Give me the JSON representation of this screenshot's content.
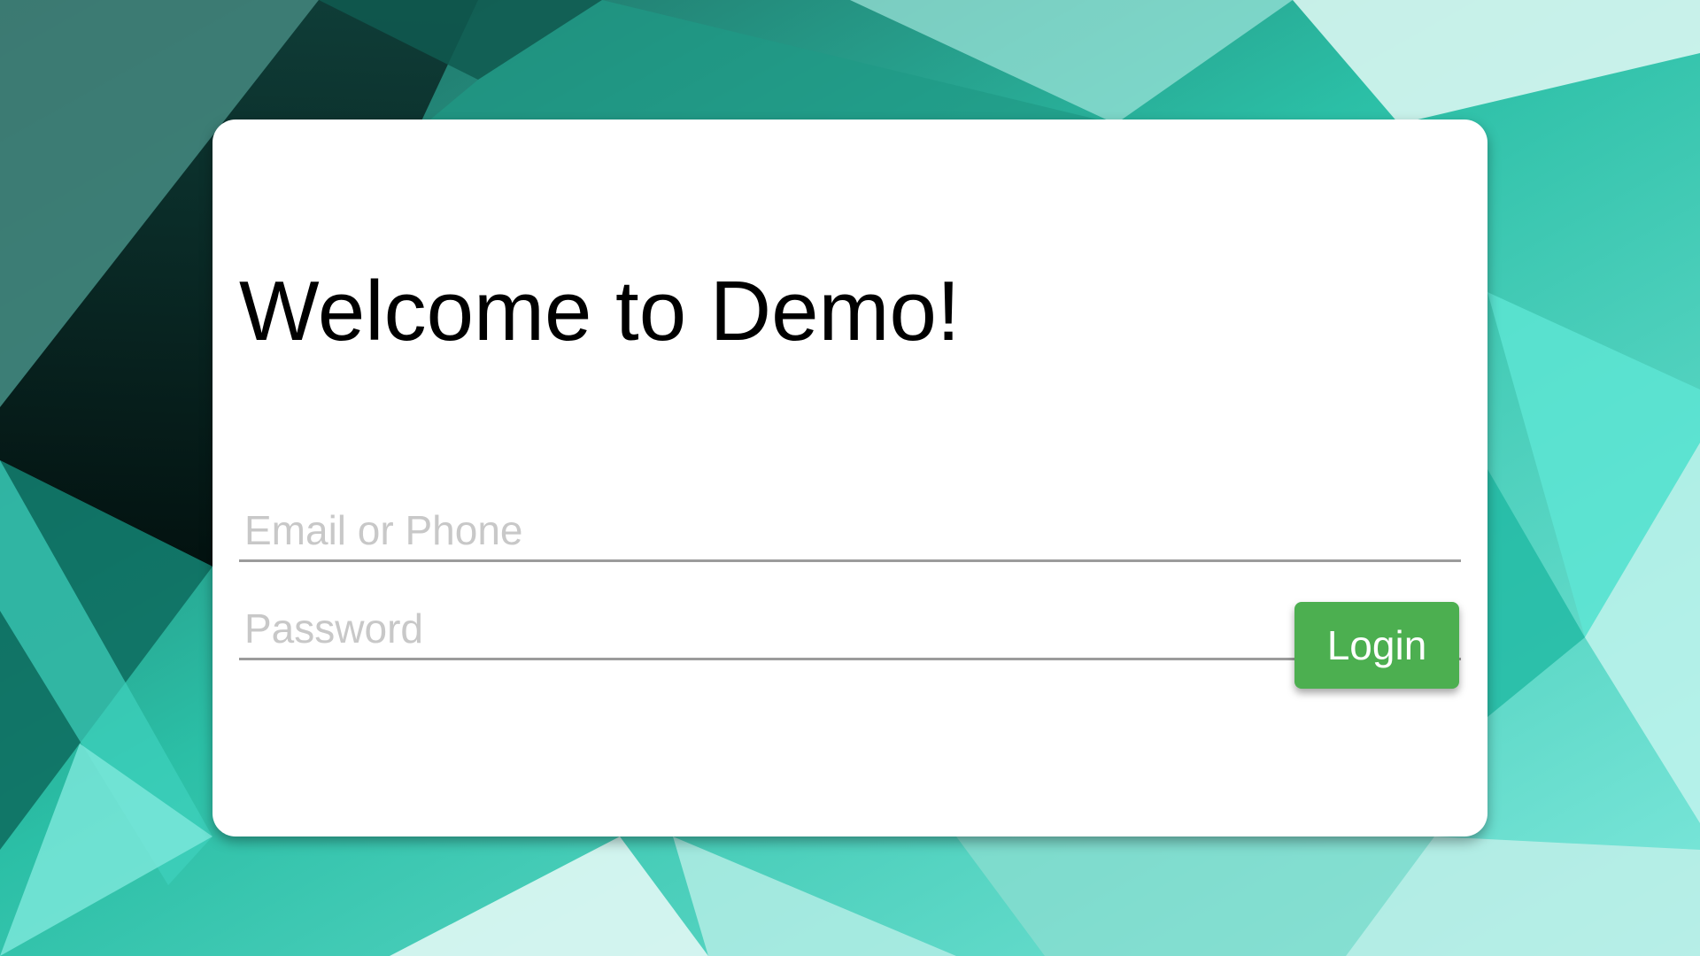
{
  "login_card": {
    "title": "Welcome to Demo!",
    "email_placeholder": "Email or Phone",
    "password_placeholder": "Password",
    "login_label": "Login"
  },
  "colors": {
    "accent": "#4caf50",
    "background_teal": "#2ec9ad",
    "card": "#ffffff"
  }
}
